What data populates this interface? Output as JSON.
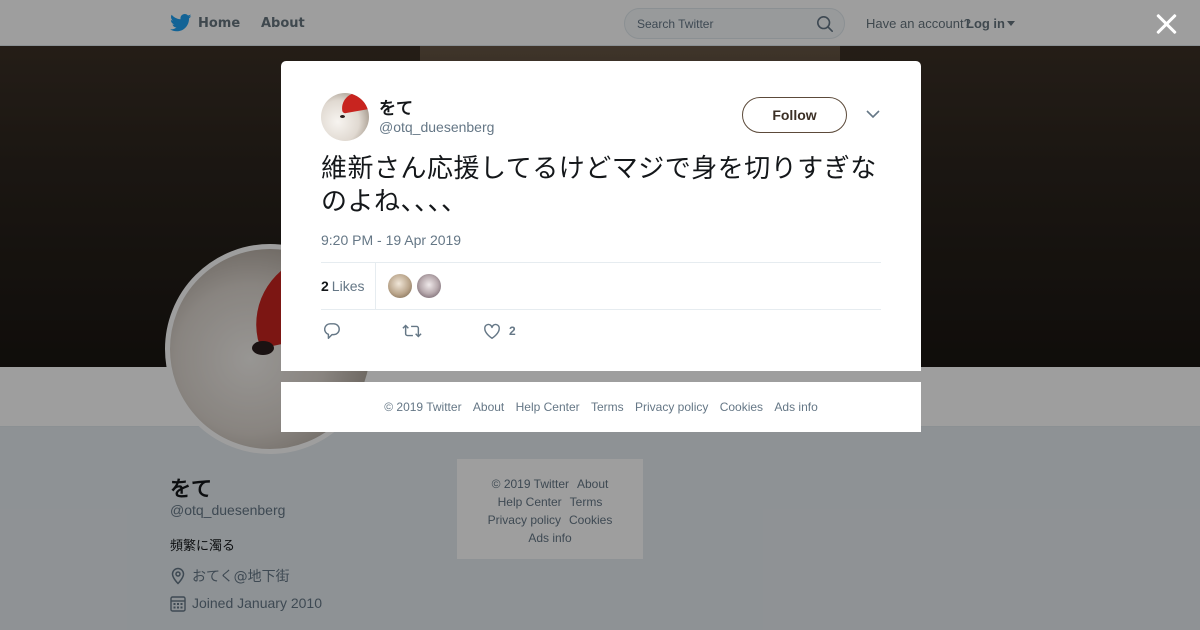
{
  "colors": {
    "twitter_blue": "#1da1f2",
    "follow_border": "#5c4a3a",
    "overlay": "rgba(0,0,0,0.38)"
  },
  "topbar": {
    "home_label": "Home",
    "about_label": "About",
    "search_placeholder": "Search Twitter",
    "account_prompt": "Have an account?",
    "login_label": "Log in"
  },
  "profile": {
    "name": "をて",
    "handle": "@otq_duesenberg",
    "bio": "頻繁に濁る",
    "location": "おてく@地下街",
    "joined": "Joined January 2010"
  },
  "side_footer": {
    "links": [
      "© 2019 Twitter",
      "About",
      "Help Center",
      "Terms",
      "Privacy policy",
      "Cookies",
      "Ads info"
    ]
  },
  "tweet": {
    "author_name": "をて",
    "author_handle": "@otq_duesenberg",
    "follow_label": "Follow",
    "text": "維新さん応援してるけどマジで身を切りすぎなのよね、、、、",
    "timestamp": "9:20 PM - 19 Apr 2019",
    "likes_count": "2",
    "likes_label": "Likes",
    "like_action_count": "2"
  },
  "modal_footer": {
    "links": [
      "© 2019 Twitter",
      "About",
      "Help Center",
      "Terms",
      "Privacy policy",
      "Cookies",
      "Ads info"
    ]
  },
  "icons": [
    "twitter-bird-icon",
    "search-icon",
    "caret-down-icon",
    "close-icon",
    "location-pin-icon",
    "calendar-icon",
    "reply-icon",
    "retweet-icon",
    "heart-icon",
    "chevron-down-icon"
  ]
}
